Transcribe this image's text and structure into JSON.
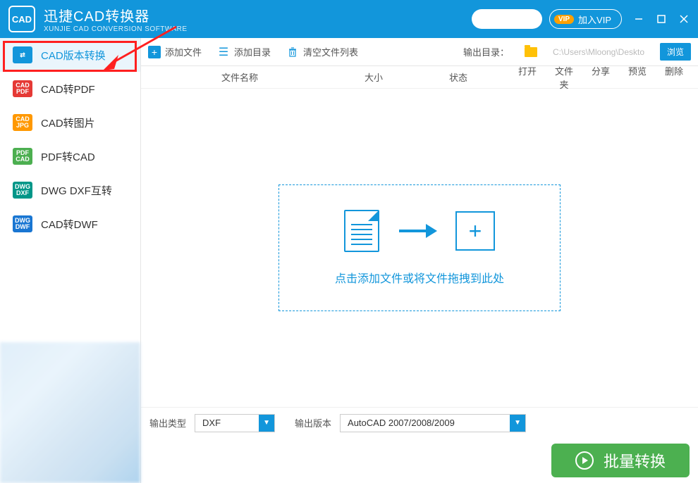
{
  "title": {
    "main": "迅捷CAD转换器",
    "sub": "XUNJIE CAD CONVERSION SOFTWARE"
  },
  "vip": {
    "badge": "VIP",
    "label": "加入VIP"
  },
  "sidebar": {
    "items": [
      {
        "label": "CAD版本转换"
      },
      {
        "label": "CAD转PDF"
      },
      {
        "label": "CAD转图片"
      },
      {
        "label": "PDF转CAD"
      },
      {
        "label": "DWG DXF互转"
      },
      {
        "label": "CAD转DWF"
      }
    ]
  },
  "toolbar": {
    "add_file": "添加文件",
    "add_dir": "添加目录",
    "clear_list": "清空文件列表",
    "out_label": "输出目录：",
    "out_path": "C:\\Users\\Mloong\\Desktop",
    "browse": "浏览"
  },
  "columns": {
    "name": "文件名称",
    "size": "大小",
    "status": "状态",
    "open": "打开",
    "folder": "文件夹",
    "share": "分享",
    "preview": "预览",
    "delete": "删除"
  },
  "drop": {
    "text": "点击添加文件或将文件拖拽到此处"
  },
  "output": {
    "type_label": "输出类型",
    "type_value": "DXF",
    "ver_label": "输出版本",
    "ver_value": "AutoCAD 2007/2008/2009"
  },
  "convert": {
    "label": "批量转换"
  }
}
